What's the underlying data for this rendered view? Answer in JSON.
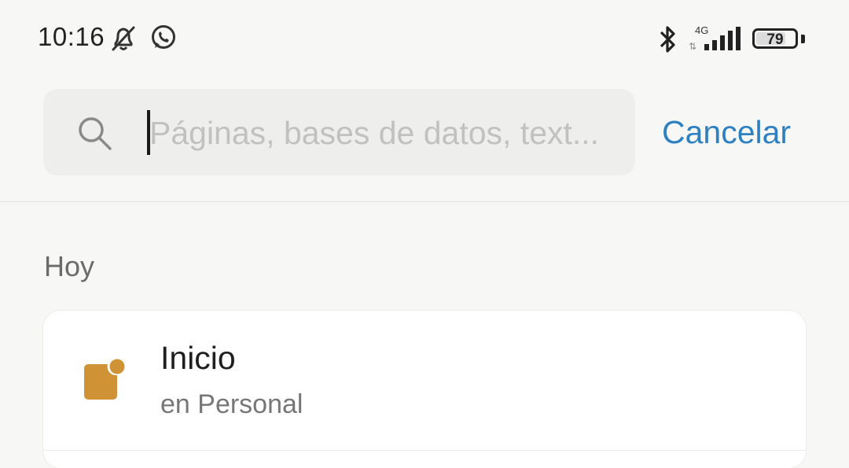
{
  "status_bar": {
    "time": "10:16",
    "network_label": "4G",
    "battery": "79",
    "battery_level": 0.79,
    "icons": [
      "bell-off-icon",
      "whatsapp-icon",
      "bluetooth-icon",
      "signal-icon",
      "battery-icon"
    ]
  },
  "search": {
    "placeholder": "Páginas, bases de datos, text...",
    "value": "",
    "cancel_label": "Cancelar",
    "accent_color": "#2f80c0"
  },
  "recent": {
    "section_label": "Hoy",
    "items": [
      {
        "title": "Inicio",
        "subtitle": "en Personal",
        "icon": "page-icon",
        "icon_color": "#cf9335"
      }
    ]
  }
}
